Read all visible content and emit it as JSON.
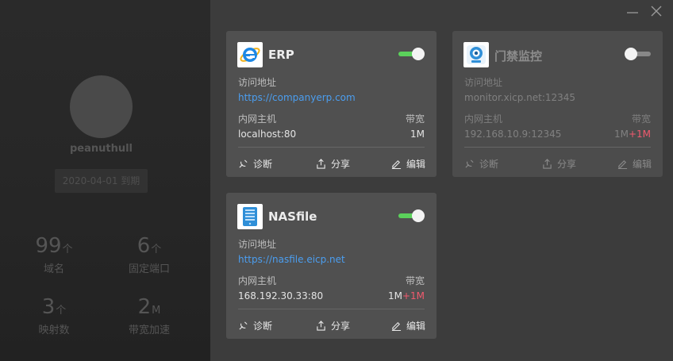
{
  "profile": {
    "username": "peanuthull",
    "expiry": "2020-04-01 到期",
    "stats": [
      {
        "num": "99",
        "unit": "个",
        "label": "域名"
      },
      {
        "num": "6",
        "unit": "个",
        "label": "固定端口"
      },
      {
        "num": "3",
        "unit": "个",
        "label": "映射数"
      },
      {
        "num": "2",
        "unit": "M",
        "label": "带宽加速"
      }
    ]
  },
  "window": {
    "minimize": "—",
    "close": "✕"
  },
  "labels": {
    "access_address": "访问地址",
    "internal_host": "内网主机",
    "bandwidth": "带宽",
    "diagnose": "诊断",
    "share": "分享",
    "edit": "编辑"
  },
  "cards": [
    {
      "title": "ERP",
      "enabled": true,
      "icon": "ie-icon",
      "url": "https://companyerp.com",
      "host": "localhost:80",
      "bandwidth": "1M",
      "bandwidth_extra": ""
    },
    {
      "title": "门禁监控",
      "enabled": false,
      "icon": "camera-icon",
      "url": "monitor.xicp.net:12345",
      "host": "192.168.10.9:12345",
      "bandwidth": "1M",
      "bandwidth_extra": "+1M"
    },
    {
      "title": "NASfile",
      "enabled": true,
      "icon": "nas-icon",
      "url": "https://nasfile.eicp.net",
      "host": "168.192.30.33:80",
      "bandwidth": "1M",
      "bandwidth_extra": "+1M"
    }
  ],
  "colors": {
    "toggle_on": "#5bd15b",
    "link": "#4b9ef0",
    "extra_bandwidth": "#f05a6e"
  }
}
